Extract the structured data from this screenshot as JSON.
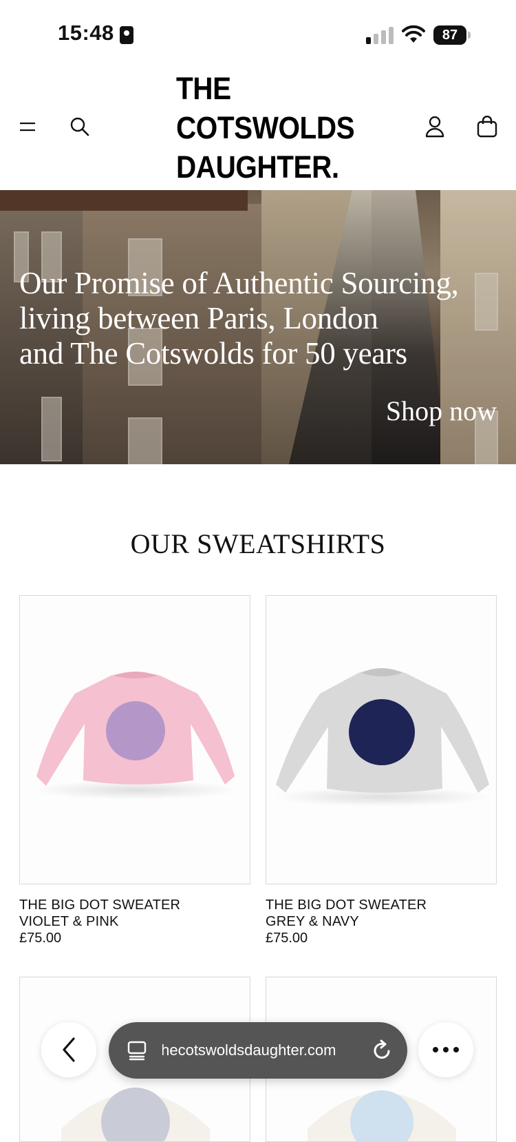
{
  "status_bar": {
    "time": "15:48",
    "battery": "87"
  },
  "header": {
    "logo_lines": [
      "THE",
      "COTSWOLDS",
      "DAUGHTER."
    ],
    "icons": [
      "menu-icon",
      "search-icon",
      "account-icon",
      "bag-icon"
    ]
  },
  "hero": {
    "lines": [
      "Our Promise of Authentic Sourcing,",
      "living between Paris, London",
      "and The Cotswolds for 50 years"
    ],
    "cta": "Shop now"
  },
  "section": {
    "title": "OUR SWEATSHIRTS"
  },
  "products": [
    {
      "name_line1": "THE BIG DOT SWEATER",
      "name_line2": "VIOLET & PINK",
      "price": "£75.00",
      "body_color": "#f5c0cf",
      "dot_color": "#b497c8"
    },
    {
      "name_line1": "THE BIG DOT SWEATER",
      "name_line2": "GREY & NAVY",
      "price": "£75.00",
      "body_color": "#d9d9d9",
      "dot_color": "#1f2456"
    }
  ],
  "browser": {
    "url": "thecotswoldsdaughter.com"
  }
}
